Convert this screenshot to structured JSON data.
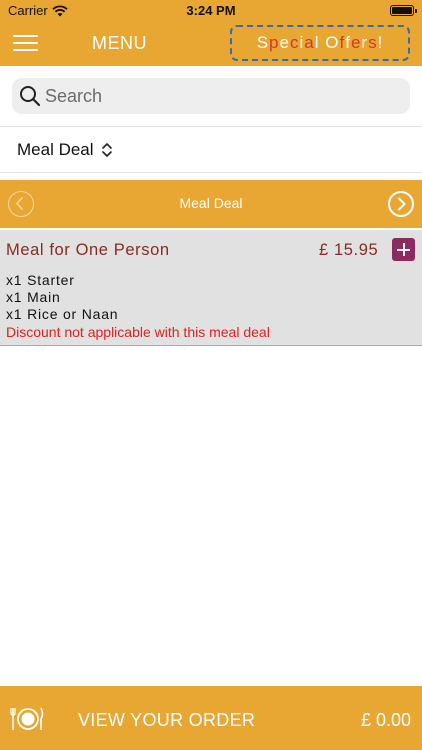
{
  "status_bar": {
    "carrier": "Carrier",
    "time": "3:24 PM"
  },
  "nav": {
    "title": "MENU",
    "offers_chars": [
      {
        "ch": "S",
        "color": "#ffffff"
      },
      {
        "ch": "p",
        "color": "#cf3a2c"
      },
      {
        "ch": "e",
        "color": "#ffffff"
      },
      {
        "ch": "c",
        "color": "#cf3a2c"
      },
      {
        "ch": "i",
        "color": "#ffffff"
      },
      {
        "ch": "a",
        "color": "#cf3a2c"
      },
      {
        "ch": "l",
        "color": "#ffffff"
      },
      {
        "ch": " ",
        "color": "#ffffff"
      },
      {
        "ch": "O",
        "color": "#ffffff"
      },
      {
        "ch": "f",
        "color": "#cf3a2c"
      },
      {
        "ch": "f",
        "color": "#ffffff"
      },
      {
        "ch": "e",
        "color": "#cf3a2c"
      },
      {
        "ch": "r",
        "color": "#ffffff"
      },
      {
        "ch": "s",
        "color": "#cf3a2c"
      },
      {
        "ch": "!",
        "color": "#ffffff"
      }
    ]
  },
  "search": {
    "placeholder": "Search",
    "value": ""
  },
  "category": {
    "selected": "Meal Deal"
  },
  "section": {
    "title": "Meal Deal"
  },
  "item": {
    "name": "Meal for One Person",
    "price": "£ 15.95",
    "lines": [
      "x1 Starter",
      "x1 Main",
      "x1 Rice or Naan"
    ],
    "note": "Discount not applicable with this meal deal"
  },
  "bottom": {
    "label": "VIEW YOUR ORDER",
    "total": "£ 0.00"
  },
  "colors": {
    "accent": "#e8a732",
    "item_text": "#8b2a1f",
    "add_button": "#8b2b5f",
    "note": "#e0221b",
    "offers_alt": "#cf3a2c"
  }
}
